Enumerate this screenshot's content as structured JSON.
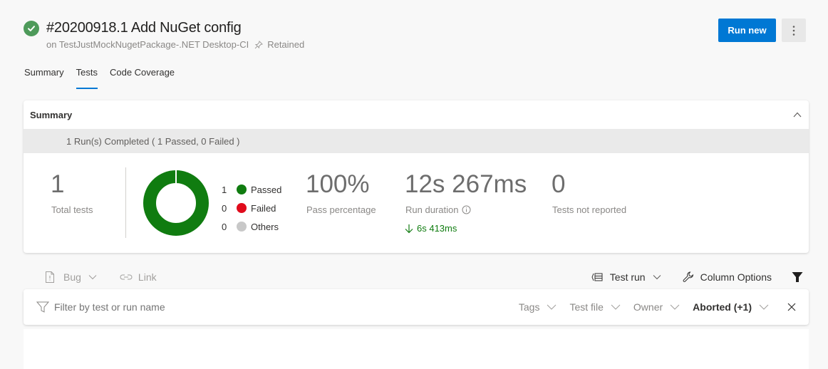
{
  "header": {
    "title": "#20200918.1 Add NuGet config",
    "pipeline": "on TestJustMockNugetPackage-.NET Desktop-CI",
    "retained": "Retained",
    "status": "succeeded",
    "run_new_label": "Run new"
  },
  "tabs": [
    {
      "label": "Summary",
      "active": false
    },
    {
      "label": "Tests",
      "active": true
    },
    {
      "label": "Code Coverage",
      "active": false
    }
  ],
  "summary": {
    "title": "Summary",
    "runs_banner": "1 Run(s) Completed ( 1 Passed, 0 Failed )",
    "total_tests": "1",
    "total_tests_label": "Total tests",
    "outcomes": [
      {
        "count": "1",
        "label": "Passed",
        "color": "#107c10"
      },
      {
        "count": "0",
        "label": "Failed",
        "color": "#e00b1c"
      },
      {
        "count": "0",
        "label": "Others",
        "color": "#c8c8c8"
      }
    ],
    "pass_percentage": "100%",
    "pass_percentage_label": "Pass percentage",
    "run_duration": "12s 267ms",
    "run_duration_label": "Run duration",
    "duration_delta": "6s 413ms",
    "not_reported": "0",
    "not_reported_label": "Tests not reported"
  },
  "toolbar": {
    "bug_label": "Bug",
    "link_label": "Link",
    "test_run_label": "Test run",
    "column_options_label": "Column Options"
  },
  "filters": {
    "search_placeholder": "Filter by test or run name",
    "tags": "Tags",
    "test_file": "Test file",
    "owner": "Owner",
    "outcome": "Aborted (+1)"
  },
  "colors": {
    "accent": "#0078d4",
    "passed": "#107c10",
    "failed": "#e00b1c",
    "others": "#c8c8c8",
    "status_icon": "#4e9a5a"
  }
}
